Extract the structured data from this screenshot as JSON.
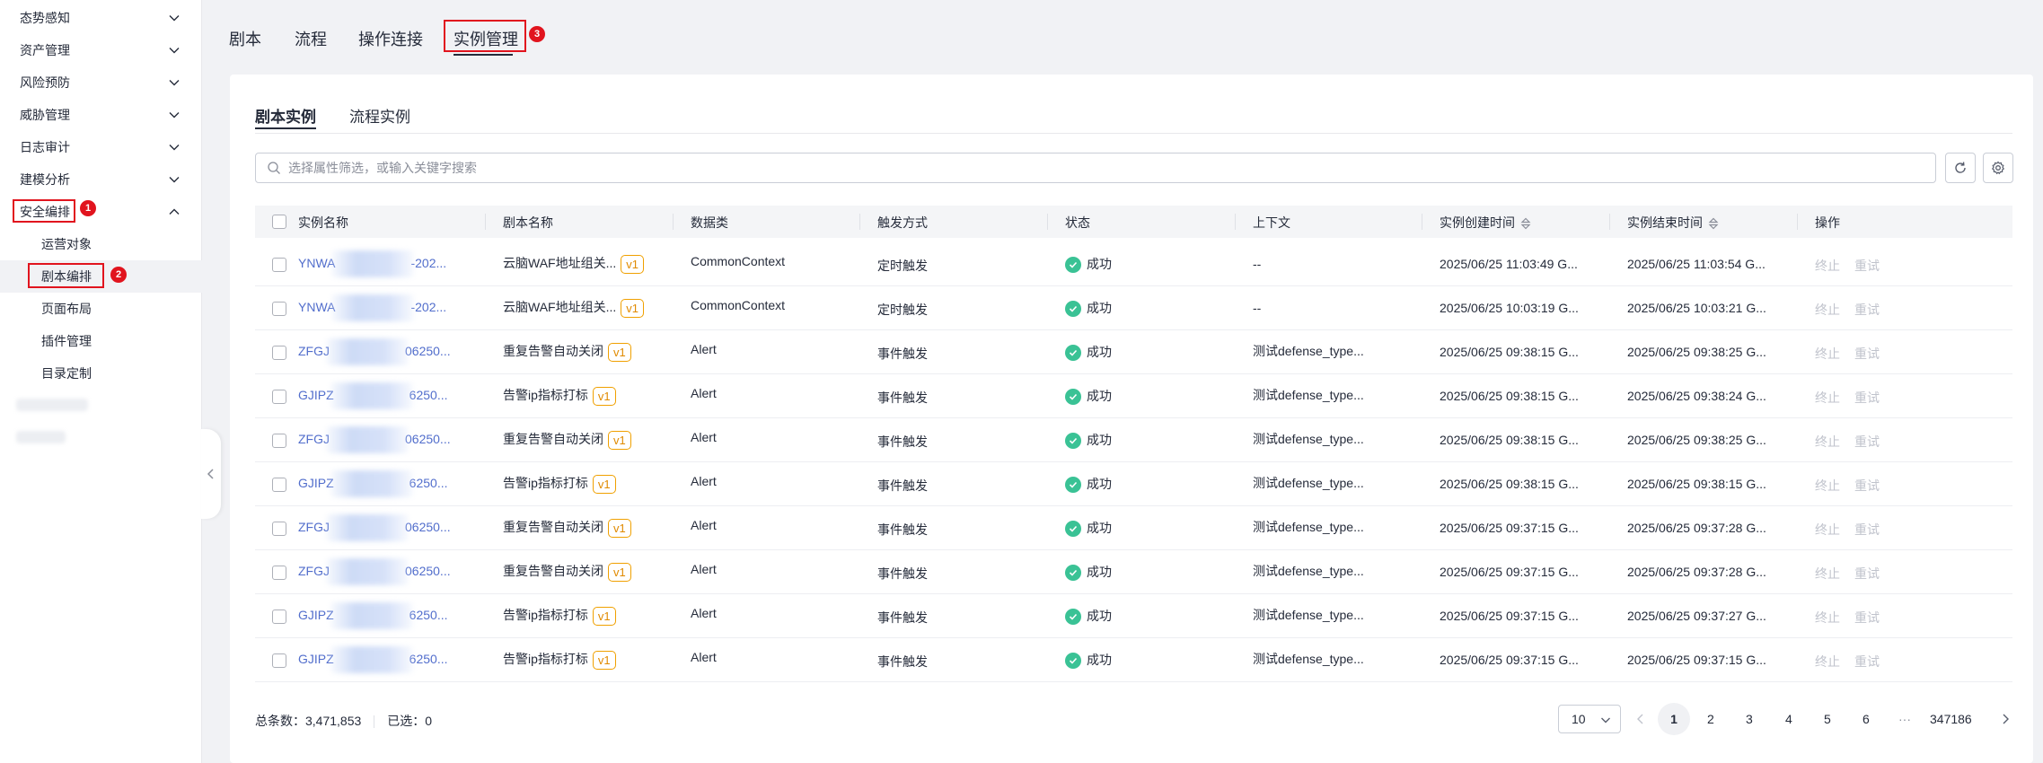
{
  "sidebar": {
    "items": [
      {
        "label": "态势感知"
      },
      {
        "label": "资产管理"
      },
      {
        "label": "风险预防"
      },
      {
        "label": "威胁管理"
      },
      {
        "label": "日志审计"
      },
      {
        "label": "建模分析"
      },
      {
        "label": "安全编排"
      }
    ],
    "subitems": [
      {
        "label": "运营对象"
      },
      {
        "label": "剧本编排"
      },
      {
        "label": "页面布局"
      },
      {
        "label": "插件管理"
      },
      {
        "label": "目录定制"
      }
    ]
  },
  "annotations": [
    "1",
    "2",
    "3"
  ],
  "top_tabs": [
    {
      "label": "剧本"
    },
    {
      "label": "流程"
    },
    {
      "label": "操作连接"
    },
    {
      "label": "实例管理"
    }
  ],
  "sub_tabs": [
    {
      "label": "剧本实例"
    },
    {
      "label": "流程实例"
    }
  ],
  "search": {
    "placeholder": "选择属性筛选，或输入关键字搜索"
  },
  "table": {
    "columns": [
      "实例名称",
      "剧本名称",
      "数据类",
      "触发方式",
      "状态",
      "上下文",
      "实例创建时间",
      "实例结束时间",
      "操作"
    ],
    "rows": [
      {
        "name_pre": "YNWA",
        "name_post": "-202...",
        "playbook": "云脑WAF地址组关...",
        "version": "v1",
        "data_class": "CommonContext",
        "trigger": "定时触发",
        "status": "成功",
        "context": "--",
        "created": "2025/06/25 11:03:49 G...",
        "ended": "2025/06/25 11:03:54 G..."
      },
      {
        "name_pre": "YNWA",
        "name_post": "-202...",
        "playbook": "云脑WAF地址组关...",
        "version": "v1",
        "data_class": "CommonContext",
        "trigger": "定时触发",
        "status": "成功",
        "context": "--",
        "created": "2025/06/25 10:03:19 G...",
        "ended": "2025/06/25 10:03:21 G..."
      },
      {
        "name_pre": "ZFGJ",
        "name_post": "06250...",
        "playbook": "重复告警自动关闭",
        "version": "v1",
        "data_class": "Alert",
        "trigger": "事件触发",
        "status": "成功",
        "context": "测试defense_type...",
        "created": "2025/06/25 09:38:15 G...",
        "ended": "2025/06/25 09:38:25 G..."
      },
      {
        "name_pre": "GJIPZ",
        "name_post": "6250...",
        "playbook": "告警ip指标打标",
        "version": "v1",
        "data_class": "Alert",
        "trigger": "事件触发",
        "status": "成功",
        "context": "测试defense_type...",
        "created": "2025/06/25 09:38:15 G...",
        "ended": "2025/06/25 09:38:24 G..."
      },
      {
        "name_pre": "ZFGJ",
        "name_post": "06250...",
        "playbook": "重复告警自动关闭",
        "version": "v1",
        "data_class": "Alert",
        "trigger": "事件触发",
        "status": "成功",
        "context": "测试defense_type...",
        "created": "2025/06/25 09:38:15 G...",
        "ended": "2025/06/25 09:38:25 G..."
      },
      {
        "name_pre": "GJIPZ",
        "name_post": "6250...",
        "playbook": "告警ip指标打标",
        "version": "v1",
        "data_class": "Alert",
        "trigger": "事件触发",
        "status": "成功",
        "context": "测试defense_type...",
        "created": "2025/06/25 09:38:15 G...",
        "ended": "2025/06/25 09:38:15 G..."
      },
      {
        "name_pre": "ZFGJ",
        "name_post": "06250...",
        "playbook": "重复告警自动关闭",
        "version": "v1",
        "data_class": "Alert",
        "trigger": "事件触发",
        "status": "成功",
        "context": "测试defense_type...",
        "created": "2025/06/25 09:37:15 G...",
        "ended": "2025/06/25 09:37:28 G..."
      },
      {
        "name_pre": "ZFGJ",
        "name_post": "06250...",
        "playbook": "重复告警自动关闭",
        "version": "v1",
        "data_class": "Alert",
        "trigger": "事件触发",
        "status": "成功",
        "context": "测试defense_type...",
        "created": "2025/06/25 09:37:15 G...",
        "ended": "2025/06/25 09:37:28 G..."
      },
      {
        "name_pre": "GJIPZ",
        "name_post": "6250...",
        "playbook": "告警ip指标打标",
        "version": "v1",
        "data_class": "Alert",
        "trigger": "事件触发",
        "status": "成功",
        "context": "测试defense_type...",
        "created": "2025/06/25 09:37:15 G...",
        "ended": "2025/06/25 09:37:27 G..."
      },
      {
        "name_pre": "GJIPZ",
        "name_post": "6250...",
        "playbook": "告警ip指标打标",
        "version": "v1",
        "data_class": "Alert",
        "trigger": "事件触发",
        "status": "成功",
        "context": "测试defense_type...",
        "created": "2025/06/25 09:37:15 G...",
        "ended": "2025/06/25 09:37:15 G..."
      }
    ],
    "actions": {
      "terminate": "终止",
      "retry": "重试"
    }
  },
  "footer": {
    "total_label": "总条数：3,471,853",
    "selected_label": "已选：0",
    "page_size": "10",
    "pages": [
      "1",
      "2",
      "3",
      "4",
      "5",
      "6"
    ],
    "ellipsis": "···",
    "last_page": "347186"
  },
  "colors": {
    "link": "#526ecc",
    "success": "#3ac295",
    "version_tag": "#f0a000",
    "annotation_red": "#e1141e"
  }
}
